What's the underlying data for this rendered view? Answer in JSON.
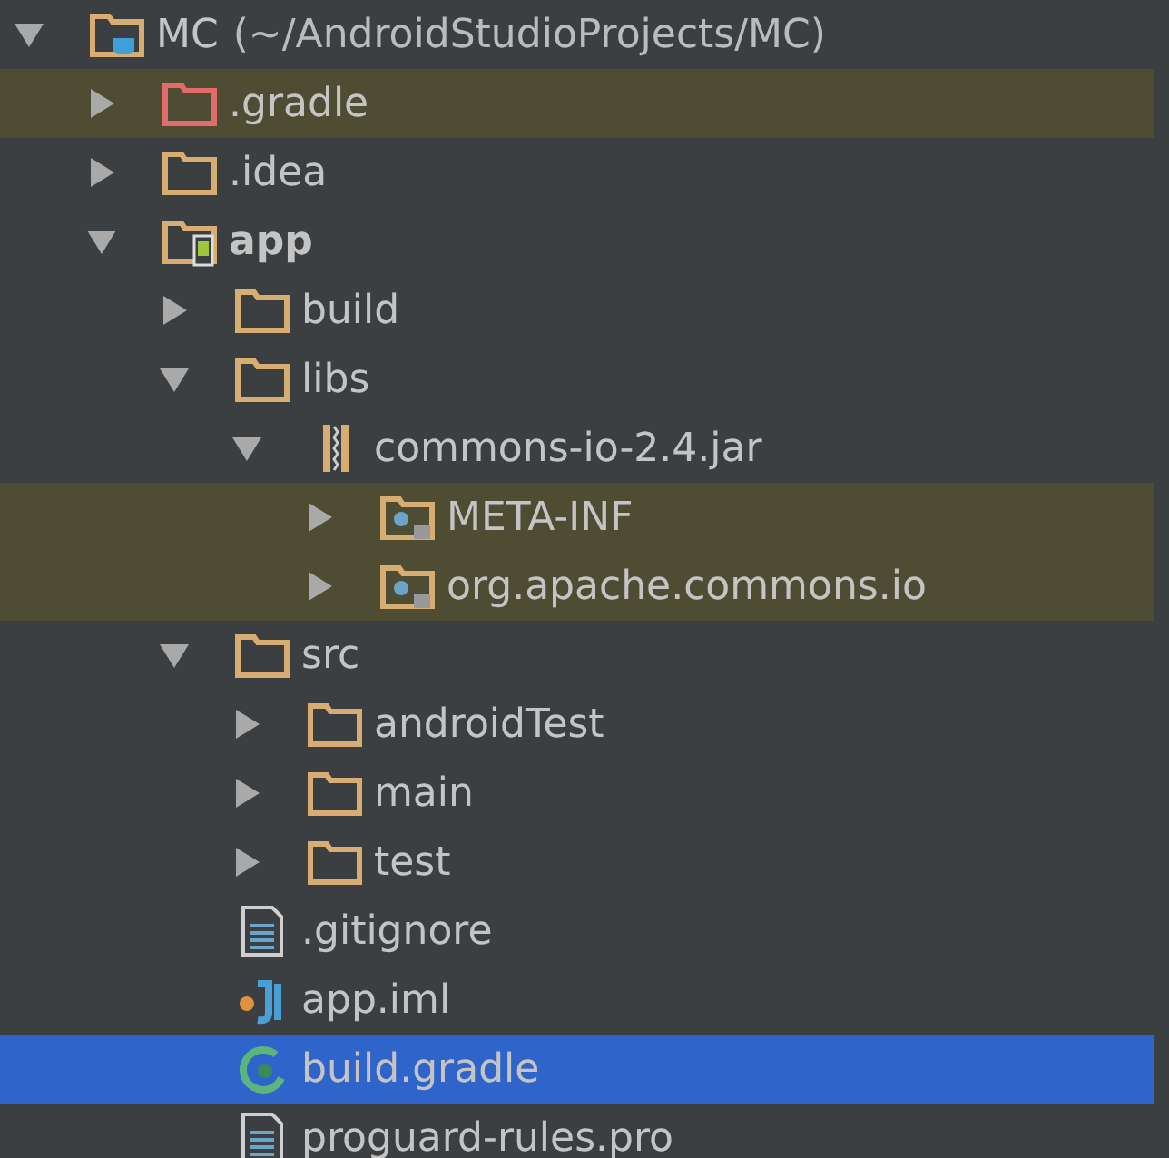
{
  "project_tree": [
    {
      "label": "MC",
      "path": "(~/AndroidStudioProjects/MC)",
      "kind": "project",
      "expanded": true,
      "selected": false,
      "highlighted": false,
      "children": [
        {
          "label": ".gradle",
          "kind": "excluded_folder",
          "expanded": false,
          "selected": false,
          "highlighted": true
        },
        {
          "label": ".idea",
          "kind": "folder",
          "expanded": false,
          "selected": false,
          "highlighted": false
        },
        {
          "label": "app",
          "kind": "module",
          "bold": true,
          "expanded": true,
          "selected": false,
          "highlighted": false,
          "children": [
            {
              "label": "build",
              "kind": "folder",
              "expanded": false,
              "selected": false,
              "highlighted": false
            },
            {
              "label": "libs",
              "kind": "folder",
              "expanded": true,
              "selected": false,
              "highlighted": false,
              "children": [
                {
                  "label": "commons-io-2.4.jar",
                  "kind": "jar",
                  "expanded": true,
                  "selected": false,
                  "highlighted": false,
                  "children": [
                    {
                      "label": "META-INF",
                      "kind": "package",
                      "expanded": false,
                      "selected": false,
                      "highlighted": true
                    },
                    {
                      "label": "org.apache.commons.io",
                      "kind": "package",
                      "expanded": false,
                      "selected": false,
                      "highlighted": true
                    }
                  ]
                }
              ]
            },
            {
              "label": "src",
              "kind": "folder",
              "expanded": true,
              "selected": false,
              "highlighted": false,
              "children": [
                {
                  "label": "androidTest",
                  "kind": "folder",
                  "expanded": false,
                  "selected": false,
                  "highlighted": false
                },
                {
                  "label": "main",
                  "kind": "folder",
                  "expanded": false,
                  "selected": false,
                  "highlighted": false
                },
                {
                  "label": "test",
                  "kind": "folder",
                  "expanded": false,
                  "selected": false,
                  "highlighted": false
                }
              ]
            },
            {
              "label": ".gitignore",
              "kind": "text_file",
              "selected": false,
              "highlighted": false
            },
            {
              "label": "app.iml",
              "kind": "iml_file",
              "selected": false,
              "highlighted": false
            },
            {
              "label": "build.gradle",
              "kind": "gradle_file",
              "selected": true,
              "highlighted": false
            },
            {
              "label": "proguard-rules.pro",
              "kind": "text_file",
              "selected": false,
              "highlighted": false
            }
          ]
        }
      ]
    }
  ]
}
